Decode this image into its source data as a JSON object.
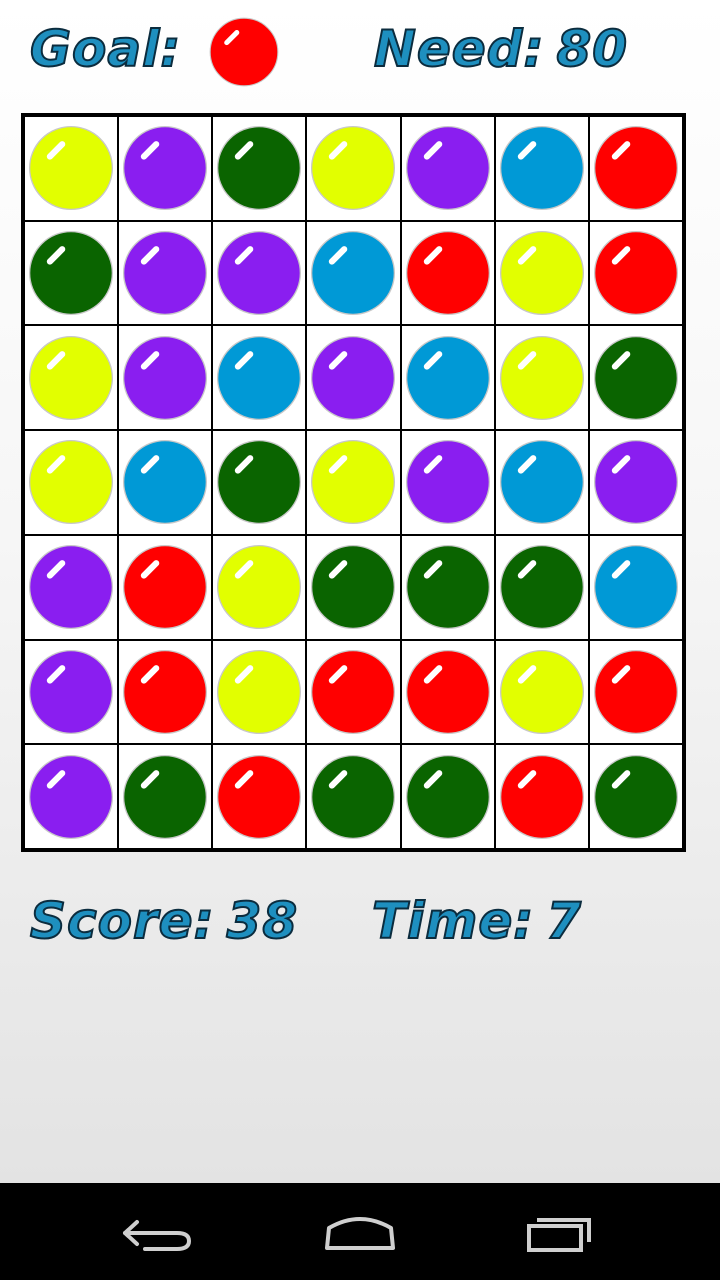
{
  "hud": {
    "goal_label": "Goal:",
    "need_label": "Need:",
    "need_value": "80",
    "goal_color": "red"
  },
  "footer": {
    "score_label": "Score:",
    "score_value": "38",
    "time_label": "Time:",
    "time_value": "7"
  },
  "palette": {
    "yellow": "#e2ff00",
    "purple": "#8a1ef0",
    "green": "#0a6400",
    "blue": "#0099d6",
    "red": "#ff0000"
  },
  "board": [
    [
      "yellow",
      "purple",
      "green",
      "yellow",
      "purple",
      "blue",
      "red"
    ],
    [
      "green",
      "purple",
      "purple",
      "blue",
      "red",
      "yellow",
      "red"
    ],
    [
      "yellow",
      "purple",
      "blue",
      "purple",
      "blue",
      "yellow",
      "green"
    ],
    [
      "yellow",
      "blue",
      "green",
      "yellow",
      "purple",
      "blue",
      "purple"
    ],
    [
      "purple",
      "red",
      "yellow",
      "green",
      "green",
      "green",
      "blue"
    ],
    [
      "purple",
      "red",
      "yellow",
      "red",
      "red",
      "yellow",
      "red"
    ],
    [
      "purple",
      "green",
      "red",
      "green",
      "green",
      "red",
      "green"
    ]
  ],
  "navbar": {
    "icons": [
      "back-icon",
      "home-icon",
      "recent-apps-icon"
    ]
  }
}
